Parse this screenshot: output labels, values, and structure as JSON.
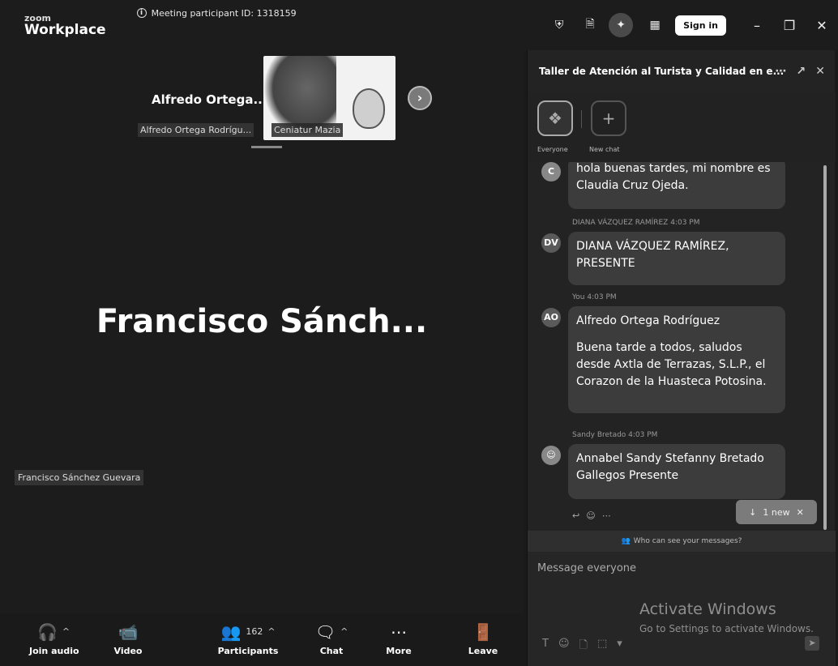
{
  "titlebar": {
    "brand_top": "zoom",
    "brand_bottom": "Workplace",
    "meeting_id": "Meeting participant ID: 1318159",
    "signin_label": "Sign in"
  },
  "stage": {
    "thumb_name": "Alfredo  Ortega...",
    "thumb_tag": "Alfredo Ortega Rodrígu...",
    "thumb2_tag": "Ceniatur Mazia",
    "main_name": "Francisco  Sánch...",
    "speaker_tag": "Francisco Sánchez Guevara"
  },
  "controls": {
    "join_audio": "Join audio",
    "video": "Video",
    "participants": "Participants",
    "participants_count": "162",
    "chat": "Chat",
    "more": "More",
    "leave": "Leave"
  },
  "chat": {
    "title": "Taller de Atención al Turista y Calidad en e...",
    "tab_everyone": "Everyone",
    "tab_new_chat": "New chat",
    "messages": [
      {
        "initials": "C",
        "meta": "",
        "text": "hola buenas tardes, mi nombre es Claudia Cruz Ojeda."
      },
      {
        "initials": "DV",
        "meta": "DIANA VÁZQUEZ RAMÍREZ 4:03 PM",
        "text": "DIANA VÁZQUEZ RAMÍREZ, PRESENTE"
      },
      {
        "initials": "AO",
        "meta": "You 4:03 PM",
        "line1": "Alfredo Ortega Rodríguez",
        "line2": "Buena tarde a todos, saludos desde Axtla de Terrazas, S.L.P., el Corazon de la Huasteca Potosina."
      },
      {
        "initials": "",
        "meta": "Sandy Bretado 4:03 PM",
        "text": "Annabel Sandy Stefanny Bretado Gallegos Presente"
      }
    ],
    "new_pill": "1 new",
    "who_can_see": "Who can see your messages?",
    "compose_placeholder": "Message everyone",
    "watermark_title": "Activate Windows",
    "watermark_sub": "Go to Settings to activate Windows."
  }
}
